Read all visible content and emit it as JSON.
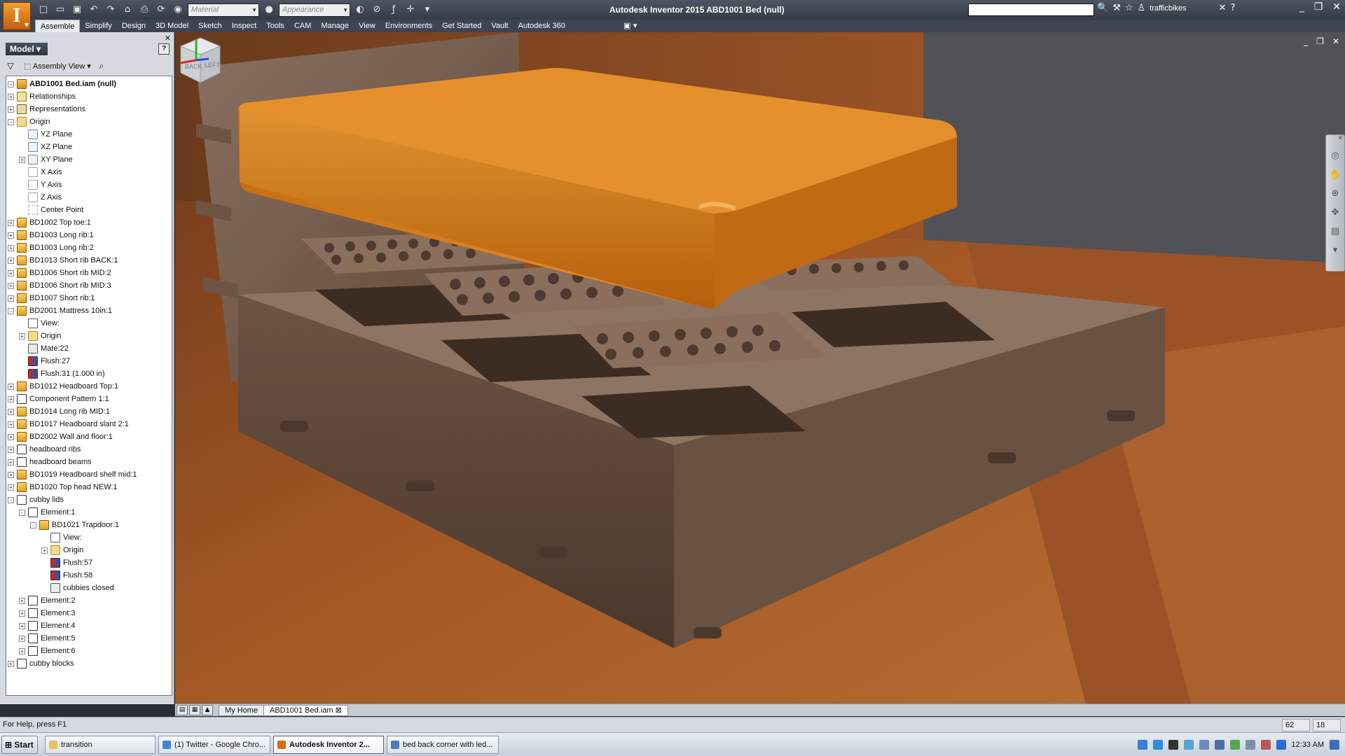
{
  "titlebar": {
    "app_logo": "I",
    "material_placeholder": "Material",
    "appearance_placeholder": "Appearance",
    "title": "Autodesk Inventor 2015   ABD1001 Bed (null)",
    "user": "trafficbikes"
  },
  "menu": {
    "items": [
      "Assemble",
      "Simplify",
      "Design",
      "3D Model",
      "Sketch",
      "Inspect",
      "Tools",
      "CAM",
      "Manage",
      "View",
      "Environments",
      "Get Started",
      "Vault",
      "Autodesk 360"
    ],
    "active": "Assemble"
  },
  "browser": {
    "tab": "Model",
    "view": "Assembly View",
    "tree": [
      {
        "label": "ABD1001 Bed.iam (null)",
        "icon": "assembly-icon",
        "depth": 0,
        "exp": "-",
        "root": true
      },
      {
        "label": "Relationships",
        "icon": "relationships-icon",
        "depth": 0,
        "exp": "+"
      },
      {
        "label": "Representations",
        "icon": "representations-icon",
        "depth": 0,
        "exp": "+"
      },
      {
        "label": "Origin",
        "icon": "folder-icon",
        "depth": 0,
        "exp": "-"
      },
      {
        "label": "YZ Plane",
        "icon": "plane-icon",
        "depth": 1,
        "exp": ""
      },
      {
        "label": "XZ Plane",
        "icon": "plane-icon",
        "depth": 1,
        "exp": ""
      },
      {
        "label": "XY Plane",
        "icon": "plane-icon",
        "depth": 1,
        "exp": "+"
      },
      {
        "label": "X Axis",
        "icon": "axis-icon",
        "depth": 1,
        "exp": ""
      },
      {
        "label": "Y Axis",
        "icon": "axis-icon",
        "depth": 1,
        "exp": ""
      },
      {
        "label": "Z Axis",
        "icon": "axis-icon",
        "depth": 1,
        "exp": ""
      },
      {
        "label": "Center Point",
        "icon": "point-icon",
        "depth": 1,
        "exp": ""
      },
      {
        "label": "BD1002 Top toe:1",
        "icon": "part-icon",
        "depth": 0,
        "exp": "+"
      },
      {
        "label": "BD1003 Long rib:1",
        "icon": "part-icon",
        "depth": 0,
        "exp": "+"
      },
      {
        "label": "BD1003 Long rib:2",
        "icon": "part-icon",
        "depth": 0,
        "exp": "+"
      },
      {
        "label": "BD1013 Short rib BACK:1",
        "icon": "part-icon",
        "depth": 0,
        "exp": "+"
      },
      {
        "label": "BD1006 Short rib MID:2",
        "icon": "part-icon",
        "depth": 0,
        "exp": "+"
      },
      {
        "label": "BD1006 Short rib MID:3",
        "icon": "part-icon",
        "depth": 0,
        "exp": "+"
      },
      {
        "label": "BD1007 Short rib:1",
        "icon": "part-icon",
        "depth": 0,
        "exp": "+"
      },
      {
        "label": "BD2001 Mattress 10in:1",
        "icon": "part-icon",
        "depth": 0,
        "exp": "-"
      },
      {
        "label": "View:",
        "icon": "view-icon",
        "depth": 1,
        "exp": ""
      },
      {
        "label": "Origin",
        "icon": "folder-icon",
        "depth": 1,
        "exp": "+"
      },
      {
        "label": "Mate:22",
        "icon": "mate-icon",
        "depth": 1,
        "exp": ""
      },
      {
        "label": "Flush:27",
        "icon": "flush-icon",
        "depth": 1,
        "exp": ""
      },
      {
        "label": "Flush:31 (1.000 in)",
        "icon": "flush-icon",
        "depth": 1,
        "exp": ""
      },
      {
        "label": "BD1012 Headboard Top:1",
        "icon": "part-icon",
        "depth": 0,
        "exp": "+"
      },
      {
        "label": "Component Pattern 1:1",
        "icon": "pattern-icon",
        "depth": 0,
        "exp": "+"
      },
      {
        "label": "BD1014 Long rib MID:1",
        "icon": "part-icon",
        "depth": 0,
        "exp": "+"
      },
      {
        "label": "BD1017 Headboard slant 2:1",
        "icon": "part-icon",
        "depth": 0,
        "exp": "+"
      },
      {
        "label": "BD2002 Wall and floor:1",
        "icon": "part-icon",
        "depth": 0,
        "exp": "+"
      },
      {
        "label": "headboard ribs",
        "icon": "pattern-icon",
        "depth": 0,
        "exp": "+"
      },
      {
        "label": "headboard beams",
        "icon": "pattern-icon",
        "depth": 0,
        "exp": "+"
      },
      {
        "label": "BD1019 Headboard shelf mid:1",
        "icon": "part-icon",
        "depth": 0,
        "exp": "+"
      },
      {
        "label": "BD1020 Top head NEW:1",
        "icon": "part-icon",
        "depth": 0,
        "exp": "+"
      },
      {
        "label": "cubby lids",
        "icon": "pattern-icon",
        "depth": 0,
        "exp": "-"
      },
      {
        "label": "Element:1",
        "icon": "pattern-icon",
        "depth": 1,
        "exp": "-"
      },
      {
        "label": "BD1021 Trapdoor:1",
        "icon": "part-icon",
        "depth": 2,
        "exp": "-"
      },
      {
        "label": "View:",
        "icon": "view-icon",
        "depth": 3,
        "exp": ""
      },
      {
        "label": "Origin",
        "icon": "folder-icon",
        "depth": 3,
        "exp": "+"
      },
      {
        "label": "Flush:57",
        "icon": "flush-icon",
        "depth": 3,
        "exp": ""
      },
      {
        "label": "Flush:58",
        "icon": "flush-icon",
        "depth": 3,
        "exp": ""
      },
      {
        "label": "cubbies closed",
        "icon": "mate-icon",
        "depth": 3,
        "exp": ""
      },
      {
        "label": "Element:2",
        "icon": "pattern-icon",
        "depth": 1,
        "exp": "+"
      },
      {
        "label": "Element:3",
        "icon": "pattern-icon",
        "depth": 1,
        "exp": "+"
      },
      {
        "label": "Element:4",
        "icon": "pattern-icon",
        "depth": 1,
        "exp": "+"
      },
      {
        "label": "Element:5",
        "icon": "pattern-icon",
        "depth": 1,
        "exp": "+"
      },
      {
        "label": "Element:6",
        "icon": "pattern-icon",
        "depth": 1,
        "exp": "+"
      },
      {
        "label": "cubby blocks",
        "icon": "pattern-icon",
        "depth": 0,
        "exp": "+"
      }
    ]
  },
  "viewcube": {
    "back": "BACK",
    "left": "LEFT"
  },
  "doc_tabs": [
    "My Home",
    "ABD1001 Bed.iam"
  ],
  "status": {
    "help": "For Help, press F1",
    "num1": "62",
    "num2": "18"
  },
  "taskbar": {
    "start": "Start",
    "tasks": [
      {
        "label": "transition",
        "active": false
      },
      {
        "label": "(1) Twitter - Google Chro...",
        "active": false
      },
      {
        "label": "Autodesk Inventor 2...",
        "active": true
      },
      {
        "label": "bed back corner with led...",
        "active": false
      }
    ],
    "clock": "12:33 AM"
  },
  "colors": {
    "mattress": "#d9821f",
    "wood": "#7a5e4a",
    "floor": "#a9612b",
    "wall": "#55575c"
  }
}
